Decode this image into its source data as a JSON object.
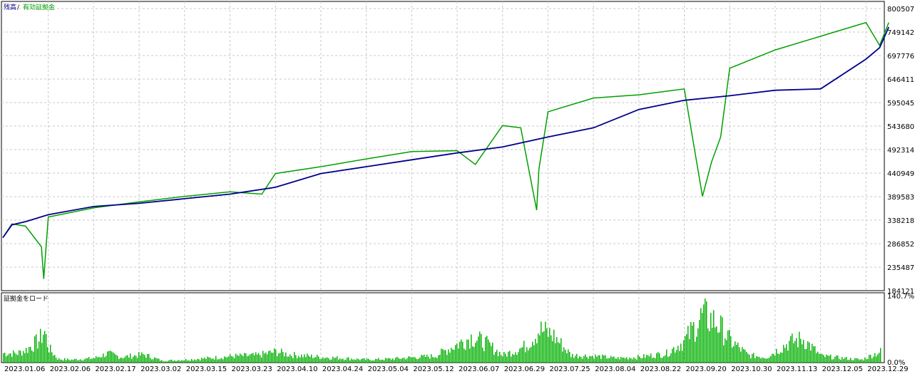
{
  "header": {
    "balance_label": "残高",
    "separator": "/",
    "equity_label": "有効証拠金",
    "margin_label": "証拠金をロード"
  },
  "colors": {
    "balance": "#00008b",
    "equity": "#00a000",
    "bars": "#00b000",
    "grid": "#c8c8c8",
    "axis": "#000000"
  },
  "chart_data": [
    {
      "type": "line",
      "title": "",
      "grid": true,
      "y_ticks": [
        184121,
        235487,
        286852,
        338218,
        389583,
        440949,
        492314,
        543680,
        595045,
        646411,
        697776,
        749142,
        800507
      ],
      "ylim": [
        184121,
        800507
      ],
      "x_ticks": [
        "2023.01.06",
        "2023.02.06",
        "2023.02.17",
        "2023.03.02",
        "2023.03.15",
        "2023.03.23",
        "2023.04.10",
        "2023.04.24",
        "2023.05.04",
        "2023.05.12",
        "2023.06.07",
        "2023.06.29",
        "2023.07.25",
        "2023.08.04",
        "2023.08.22",
        "2023.09.20",
        "2023.10.30",
        "2023.11.13",
        "2023.12.05",
        "2023.12.29"
      ],
      "series": [
        {
          "name": "残高",
          "x": [
            0,
            0.2,
            0.5,
            1,
            2,
            3,
            4,
            5,
            6,
            7,
            8,
            9,
            10,
            11,
            12,
            13,
            14,
            15,
            16,
            17,
            18,
            19,
            19.3,
            19.5
          ],
          "values": [
            300000,
            328000,
            335000,
            350000,
            368000,
            375000,
            385000,
            395000,
            410000,
            440000,
            455000,
            470000,
            485000,
            498000,
            520000,
            540000,
            580000,
            600000,
            610000,
            622000,
            625000,
            690000,
            715000,
            760000
          ]
        },
        {
          "name": "有効証拠金",
          "x": [
            0,
            0.2,
            0.5,
            0.85,
            0.9,
            1,
            2,
            3,
            4,
            5,
            5.7,
            6,
            7,
            8,
            9,
            10,
            10.4,
            11,
            11.4,
            11.75,
            11.8,
            12,
            13,
            14,
            15,
            15.4,
            15.6,
            15.8,
            16,
            17,
            18,
            19,
            19.3,
            19.5
          ],
          "values": [
            300000,
            330000,
            325000,
            280000,
            210000,
            345000,
            365000,
            378000,
            390000,
            400000,
            395000,
            440000,
            455000,
            472000,
            488000,
            490000,
            460000,
            545000,
            540000,
            360000,
            450000,
            575000,
            605000,
            612000,
            625000,
            390000,
            465000,
            520000,
            670000,
            710000,
            740000,
            770000,
            720000,
            770000
          ]
        }
      ]
    },
    {
      "type": "bar",
      "title": "証拠金をロード",
      "ylim": [
        0,
        140.7
      ],
      "y_ticks": [
        "140.7%",
        "0.0%"
      ],
      "profile": [
        [
          0.0,
          26
        ],
        [
          0.3,
          25
        ],
        [
          0.5,
          35
        ],
        [
          0.8,
          62
        ],
        [
          0.9,
          88
        ],
        [
          1.0,
          40
        ],
        [
          1.2,
          10
        ],
        [
          1.5,
          8
        ],
        [
          2.0,
          12
        ],
        [
          2.3,
          25
        ],
        [
          2.6,
          15
        ],
        [
          3.1,
          22
        ],
        [
          3.5,
          5
        ],
        [
          4.0,
          8
        ],
        [
          4.5,
          12
        ],
        [
          5.1,
          18
        ],
        [
          5.6,
          20
        ],
        [
          6.0,
          30
        ],
        [
          6.3,
          22
        ],
        [
          7.0,
          15
        ],
        [
          7.5,
          12
        ],
        [
          8.0,
          8
        ],
        [
          8.5,
          10
        ],
        [
          9.0,
          14
        ],
        [
          9.5,
          18
        ],
        [
          10.3,
          70
        ],
        [
          10.6,
          55
        ],
        [
          11.0,
          20
        ],
        [
          11.5,
          45
        ],
        [
          11.8,
          90
        ],
        [
          12.1,
          75
        ],
        [
          12.5,
          20
        ],
        [
          13.0,
          18
        ],
        [
          13.5,
          12
        ],
        [
          14.0,
          15
        ],
        [
          14.6,
          25
        ],
        [
          15.0,
          60
        ],
        [
          15.4,
          130
        ],
        [
          15.7,
          110
        ],
        [
          16.0,
          60
        ],
        [
          16.4,
          20
        ],
        [
          16.8,
          15
        ],
        [
          17.3,
          55
        ],
        [
          17.6,
          65
        ],
        [
          18.0,
          18
        ],
        [
          18.5,
          12
        ],
        [
          18.9,
          8
        ],
        [
          19.3,
          30
        ],
        [
          19.6,
          18
        ]
      ]
    }
  ]
}
